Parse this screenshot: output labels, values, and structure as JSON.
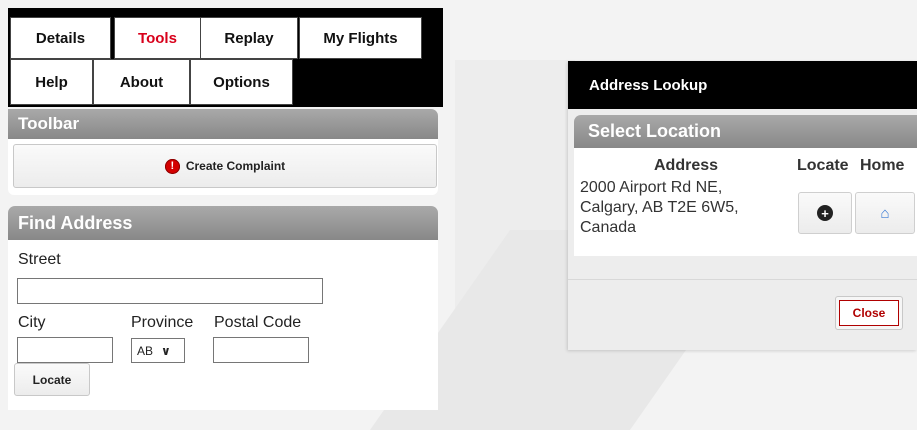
{
  "tabs": [
    {
      "label": "Details"
    },
    {
      "label": "Tools",
      "active": true
    },
    {
      "label": "Replay"
    },
    {
      "label": "My Flights"
    },
    {
      "label": "Help"
    },
    {
      "label": "About"
    },
    {
      "label": "Options"
    }
  ],
  "toolbar": {
    "title": "Toolbar",
    "complaint_label": "Create Complaint",
    "complaint_icon": "alert-icon"
  },
  "find_address": {
    "title": "Find Address",
    "street_label": "Street",
    "street_value": "",
    "city_label": "City",
    "city_value": "",
    "province_label": "Province",
    "province_value": "AB",
    "postal_label": "Postal Code",
    "postal_value": "",
    "locate_label": "Locate"
  },
  "dialog": {
    "title": "Address Lookup",
    "section_title": "Select Location",
    "columns": {
      "address": "Address",
      "locate": "Locate",
      "home": "Home"
    },
    "rows": [
      {
        "address_line1": "2000 Airport Rd NE,",
        "address_line2": "Calgary, AB T2E 6W5,",
        "address_line3": "Canada"
      }
    ],
    "close_label": "Close"
  },
  "colors": {
    "accent_red": "#d8001b",
    "title_bar": "#000000",
    "section_header": "#999999"
  }
}
